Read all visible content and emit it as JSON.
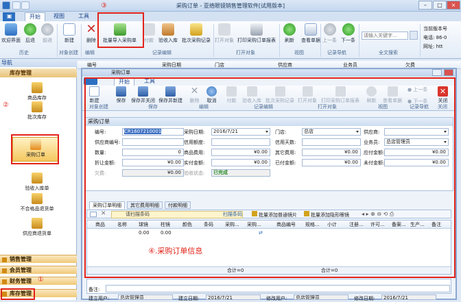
{
  "window": {
    "title": "采购订单 - 亚络眼镜销售管理软件[试用版本]",
    "tabs": [
      "开始",
      "视图",
      "工具"
    ]
  },
  "ribbon": {
    "buttons": [
      "欢迎界面",
      "后退",
      "前进",
      "新建",
      "删除",
      "批量导入采购单",
      "付款",
      "验收入库",
      "批次采购记录",
      "打开对象",
      "打印采购订单报表",
      "刷新",
      "查看单据",
      "上一条",
      "下一条"
    ],
    "groups": [
      "历史",
      "对象创建",
      "编辑",
      "记录编辑",
      "打开对象",
      "视图",
      "记录导航",
      "全文搜索"
    ],
    "search_placeholder": "请输入关键字...",
    "right_info": [
      "当前版本号",
      "电话: 86-0",
      "网址: htt"
    ]
  },
  "nav": {
    "header": "导航",
    "section": "库存管理",
    "items": [
      "商品库存",
      "批次库存",
      "采购订单",
      "验收入库单",
      "不合格品退货单",
      "供应商退货单"
    ],
    "categories": [
      "销售管理",
      "会员管理",
      "财务管理",
      "库存管理"
    ]
  },
  "list_columns": [
    "编号",
    "采购日期",
    "门店",
    "供应商",
    "业务员",
    "欠费"
  ],
  "inner": {
    "title": "采购订单",
    "tabs": [
      "开始",
      "工具"
    ],
    "buttons": [
      "新建",
      "保存",
      "保存并关闭",
      "保存并新建",
      "删除",
      "取消",
      "付款",
      "验收入库",
      "批次采购记录",
      "打开对象",
      "打印采购订单报表",
      "刷新",
      "查看单据",
      "上一条",
      "下一条",
      "关闭"
    ],
    "groups": [
      "对象创建",
      "保存",
      "编辑",
      "记录编辑",
      "打开对象",
      "视图",
      "记录导航",
      "关闭"
    ]
  },
  "form": {
    "panel_title": "采购订单",
    "number_label": "编号:",
    "number": "CR1607210001",
    "date_label": "采购日期:",
    "date": "2016/7/21",
    "store_label": "门店:",
    "store": "总店",
    "supplier_label": "供应商:",
    "supplier": "",
    "supplier_no_label": "供应商编号:",
    "credit_label": "信用额度:",
    "credit_days_label": "信用天数:",
    "salesman_label": "业务员:",
    "salesman": "总店管理员",
    "qty_label": "数量:",
    "qty": "0",
    "goods_amount_label": "商品费用:",
    "goods_amount": "¥0.00",
    "other_label": "其它费用:",
    "other": "¥0.00",
    "payable_label": "应付金额:",
    "payable": "¥0.00",
    "discount_label": "折让金额:",
    "discount": "¥0.00",
    "actual_label": "实付金额:",
    "actual": "¥0.00",
    "paid_label": "已付金额:",
    "paid": "¥0.00",
    "unpaid_label": "未付金额:",
    "unpaid": "¥0.00",
    "owe_label": "欠费:",
    "owe": "¥0.00",
    "check_label": "验收状态:",
    "check": "已完成"
  },
  "subtabs": [
    "采购订单明细",
    "其它费用明细",
    "付款明细"
  ],
  "gridtool": {
    "scan_placeholder": "请扫描条码",
    "scan_btn": "扫描条码",
    "add_normal": "批量添加普通镜片",
    "add_invisible": "批量添加隐形眼镜"
  },
  "grid": {
    "left_cols": [
      "商品",
      "名称",
      "球镜",
      "柱镜",
      "颜色",
      "条码",
      "采购...",
      "采购..."
    ],
    "right_cols": [
      "商品编号",
      "规格...",
      "小计",
      "注册...",
      "许可...",
      "备案...",
      "生产...",
      "备注"
    ],
    "row": [
      "0.00",
      "0.00"
    ],
    "total_label": "合计=0"
  },
  "bottom": {
    "note_label": "备注:",
    "creator_label": "建立用户:",
    "creator": "总店管理员",
    "created_label": "建立日期:",
    "created": "2016/7/21",
    "modifier_label": "修改用户:",
    "modifier": "总店管理员",
    "modified_label": "修改日期:",
    "modified": "2016/7/21"
  },
  "annotations": [
    "①",
    "②",
    "③",
    "④.采购订单信息"
  ]
}
